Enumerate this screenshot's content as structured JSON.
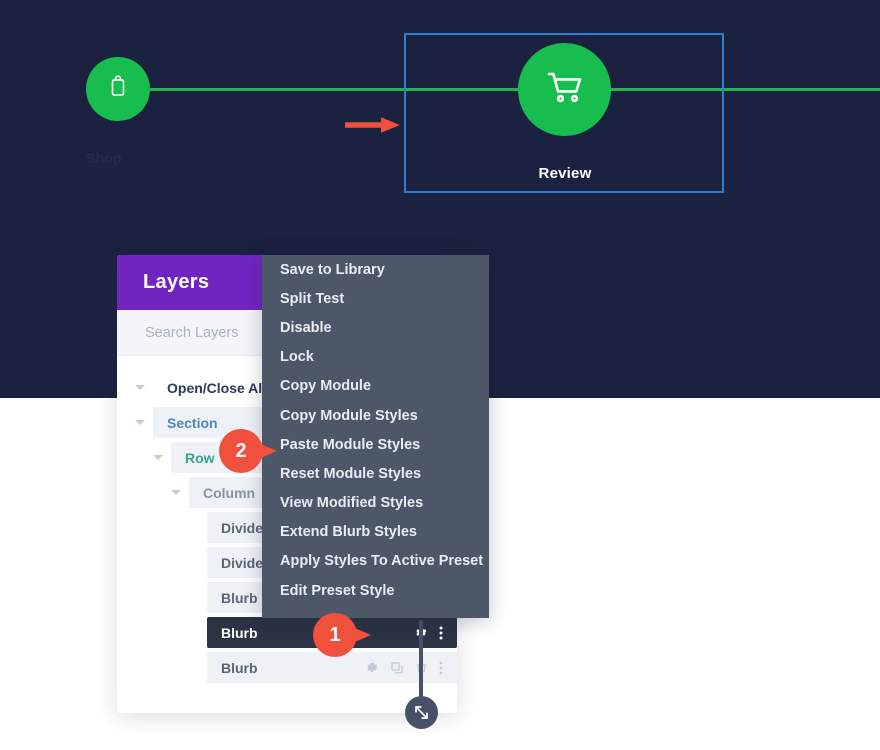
{
  "hero": {
    "background_color": "#1b2240",
    "progress_color": "#2cb04f",
    "steps": [
      {
        "label": "Shop",
        "icon": "shopping-bag-icon",
        "state": "completed"
      },
      {
        "label": "Review",
        "icon": "shopping-cart-icon",
        "state": "active"
      }
    ],
    "highlight_box_color": "#2e7fd4",
    "annotation_arrow": {
      "icon": "arrow-right-icon",
      "color": "#f0503c"
    }
  },
  "layers_panel": {
    "title": "Layers",
    "title_bar_color": "#7025c0",
    "search": {
      "placeholder": "Search Layers",
      "value": ""
    },
    "tree": [
      {
        "label": "Open/Close All",
        "level": 0,
        "type": "plain",
        "caret": true
      },
      {
        "label": "Section",
        "level": 1,
        "type": "section",
        "caret": true
      },
      {
        "label": "Row",
        "level": 2,
        "type": "row",
        "caret": true
      },
      {
        "label": "Column",
        "level": 3,
        "type": "column",
        "caret": true
      },
      {
        "label": "Divider",
        "level": 4,
        "type": "module",
        "caret": false
      },
      {
        "label": "Divider",
        "level": 4,
        "type": "module",
        "caret": false
      },
      {
        "label": "Blurb",
        "level": 4,
        "type": "module",
        "caret": false
      },
      {
        "label": "Blurb",
        "level": 4,
        "type": "selected",
        "caret": false,
        "actions": [
          "gear-icon",
          "kebab-icon"
        ]
      },
      {
        "label": "Blurb",
        "level": 4,
        "type": "module",
        "caret": false,
        "actions": [
          "gear-icon",
          "duplicate-icon",
          "trash-icon",
          "kebab-icon"
        ]
      }
    ],
    "add_button_label": "+",
    "resize_handle_icon": "resize-diagonal-icon"
  },
  "context_menu": {
    "background_color": "#4c5767",
    "items": [
      "Save to Library",
      "Split Test",
      "Disable",
      "Lock",
      "Copy Module",
      "Copy Module Styles",
      "Paste Module Styles",
      "Reset Module Styles",
      "View Modified Styles",
      "Extend Blurb Styles",
      "Apply Styles To Active Preset",
      "Edit Preset Style"
    ]
  },
  "callouts": [
    {
      "number": "1",
      "points_at": "blurb-row-kebab-menu"
    },
    {
      "number": "2",
      "points_at": "menu-item-paste-module-styles"
    }
  ]
}
